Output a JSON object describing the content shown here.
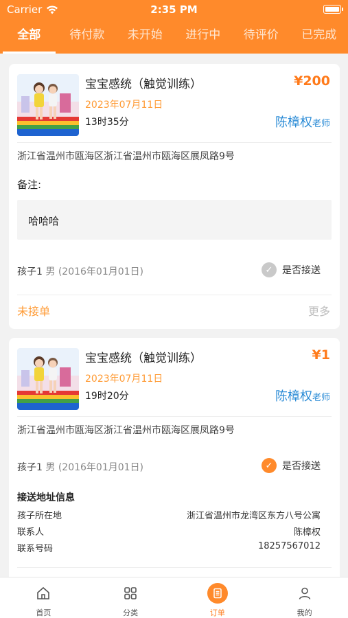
{
  "status_bar": {
    "carrier": "Carrier",
    "time": "2:35 PM"
  },
  "tabs": [
    {
      "label": "全部",
      "active": true
    },
    {
      "label": "待付款",
      "active": false
    },
    {
      "label": "未开始",
      "active": false
    },
    {
      "label": "进行中",
      "active": false
    },
    {
      "label": "待评价",
      "active": false
    },
    {
      "label": "已完成",
      "active": false
    }
  ],
  "orders": [
    {
      "title": "宝宝感统（触觉训练）",
      "price": "¥200",
      "date": "2023年07月11日",
      "time": "13时35分",
      "teacher_name": "陈樟权",
      "teacher_suffix": "老师",
      "address": "浙江省温州市瓯海区浙江省温州市瓯海区展凤路9号",
      "note_label": "备注:",
      "note": "哈哈哈",
      "child_name": "孩子1",
      "child_info": "男 (2016年01月01日)",
      "pickup_label": "是否接送",
      "pickup_checked": false,
      "status": "未接单",
      "more": "更多"
    },
    {
      "title": "宝宝感统（触觉训练）",
      "price": "¥1",
      "date": "2023年07月11日",
      "time": "19时20分",
      "teacher_name": "陈樟权",
      "teacher_suffix": "老师",
      "address": "浙江省温州市瓯海区浙江省温州市瓯海区展凤路9号",
      "child_name": "孩子1",
      "child_info": "男 (2016年01月01日)",
      "pickup_label": "是否接送",
      "pickup_checked": true,
      "pickup_info": {
        "title": "接送地址信息",
        "rows": [
          {
            "label": "孩子所在地",
            "value": "浙江省温州市龙湾区东方八号公寓"
          },
          {
            "label": "联系人",
            "value": "陈樟权"
          },
          {
            "label": "联系号码",
            "value": "18257567012"
          }
        ]
      }
    }
  ],
  "tabbar": [
    {
      "label": "首页",
      "icon": "home-icon"
    },
    {
      "label": "分类",
      "icon": "grid-icon"
    },
    {
      "label": "订单",
      "icon": "order-icon",
      "active": true
    },
    {
      "label": "我的",
      "icon": "person-icon"
    }
  ],
  "colors": {
    "brand": "#ff8a2b",
    "price": "#ff7a1a",
    "teacher": "#2a8bd6",
    "date": "#ff9a33"
  }
}
